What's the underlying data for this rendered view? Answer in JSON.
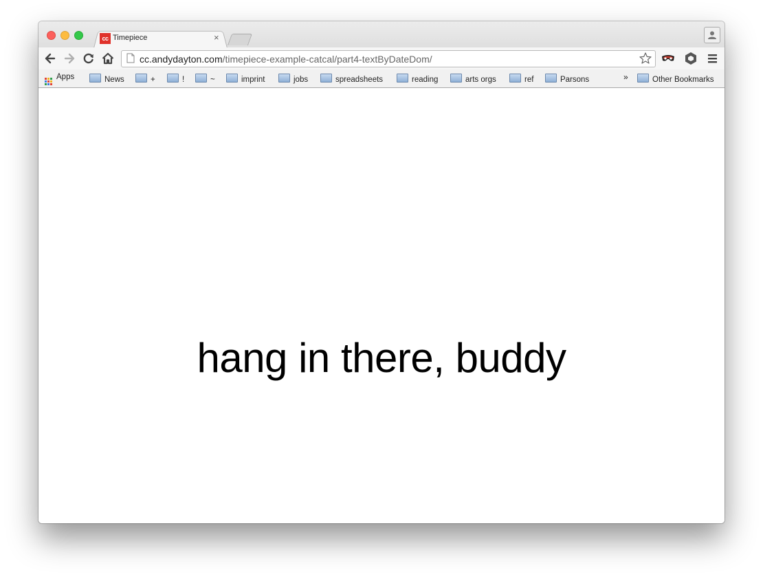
{
  "tab": {
    "favicon_text": "cc",
    "title": "Timepiece",
    "close_glyph": "×"
  },
  "address_bar": {
    "domain": "cc.andydayton.com",
    "path": "/timepiece-example-catcal/part4-textByDateDom/"
  },
  "bookmarks": {
    "apps_label": "Apps",
    "items": [
      {
        "label": "News"
      },
      {
        "label": "+"
      },
      {
        "label": "!"
      },
      {
        "label": "~"
      },
      {
        "label": "imprint"
      },
      {
        "label": "jobs"
      },
      {
        "label": "spreadsheets"
      },
      {
        "label": "reading"
      },
      {
        "label": "arts orgs"
      },
      {
        "label": "ref"
      },
      {
        "label": "Parsons"
      }
    ],
    "overflow": "»",
    "other": "Other Bookmarks"
  },
  "page": {
    "message": "hang in there, buddy"
  },
  "colors": {
    "favicon_bg": "#e0312a",
    "close": "#fc605c",
    "minimize": "#fdbc40",
    "maximize": "#34c84a"
  },
  "icons": [
    "back-icon",
    "forward-icon",
    "reload-icon",
    "home-icon",
    "page-icon",
    "star-icon",
    "mask-extension-icon",
    "hexagon-extension-icon",
    "menu-icon",
    "folder-icon",
    "apps-grid-icon",
    "profile-icon"
  ]
}
